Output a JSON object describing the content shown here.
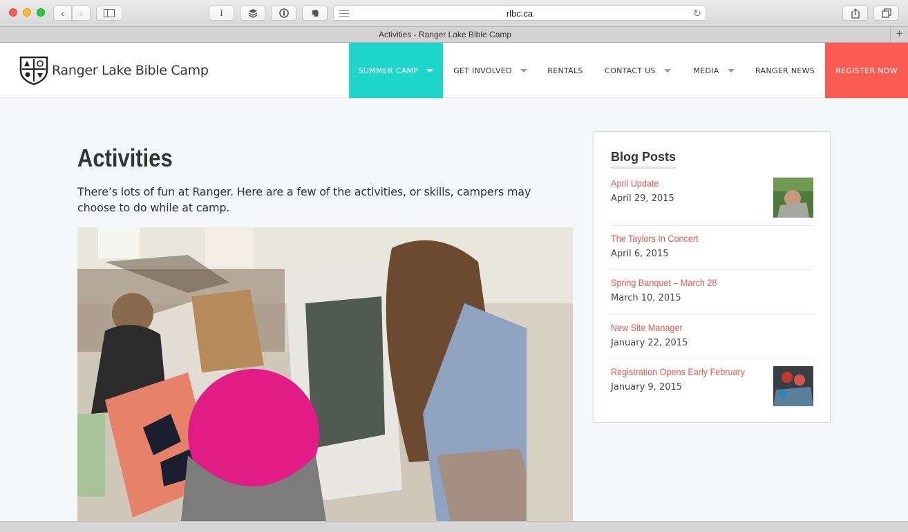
{
  "browser": {
    "url": "rlbc.ca",
    "tab_title": "Activities - Ranger Lake Bible Camp",
    "reader_label": "I"
  },
  "site": {
    "name": "Ranger Lake Bible Camp",
    "nav": [
      {
        "label": "SUMMER CAMP"
      },
      {
        "label": "GET INVOLVED"
      },
      {
        "label": "RENTALS"
      },
      {
        "label": "CONTACT US"
      },
      {
        "label": "MEDIA"
      },
      {
        "label": "RANGER NEWS"
      },
      {
        "label": "REGISTER NOW"
      }
    ],
    "colors": {
      "accent": "#1fd6cc",
      "register": "#fa5c52",
      "link": "#e8574d"
    }
  },
  "main": {
    "title": "Activities",
    "intro": "There’s lots of fun at Ranger. Here are a few of the activities, or skills, campers may choose to do while at camp."
  },
  "sidebar": {
    "title": "Blog Posts",
    "posts": [
      {
        "title": "April Update",
        "date": "April 29, 2015"
      },
      {
        "title": "The Taylors In Concert",
        "date": "April 6, 2015"
      },
      {
        "title": "Spring Banquet – March 28",
        "date": "March 10, 2015"
      },
      {
        "title": "New Site Manager",
        "date": "January 22, 2015"
      },
      {
        "title": "Registration Opens Early February",
        "date": "January 9, 2015"
      }
    ]
  }
}
